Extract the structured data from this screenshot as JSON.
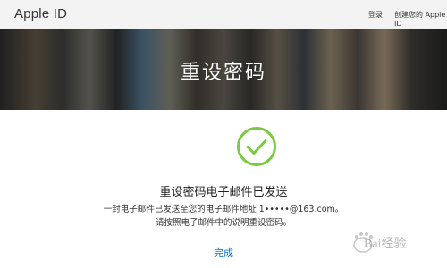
{
  "nav": {
    "brand": "Apple ID",
    "sign_in": "登录",
    "create_id": "创建您的 Apple ID"
  },
  "hero": {
    "title": "重设密码"
  },
  "confirmation": {
    "title": "重设密码电子邮件已发送",
    "line1": "一封电子邮件已发送至您的电子邮件地址 1•••••@163.com。",
    "line2": "请按照电子邮件中的说明重设密码。",
    "done": "完成"
  },
  "watermark": {
    "text": "Bai经验"
  },
  "colors": {
    "accent": "#0070c9",
    "check": "#7ac943"
  }
}
